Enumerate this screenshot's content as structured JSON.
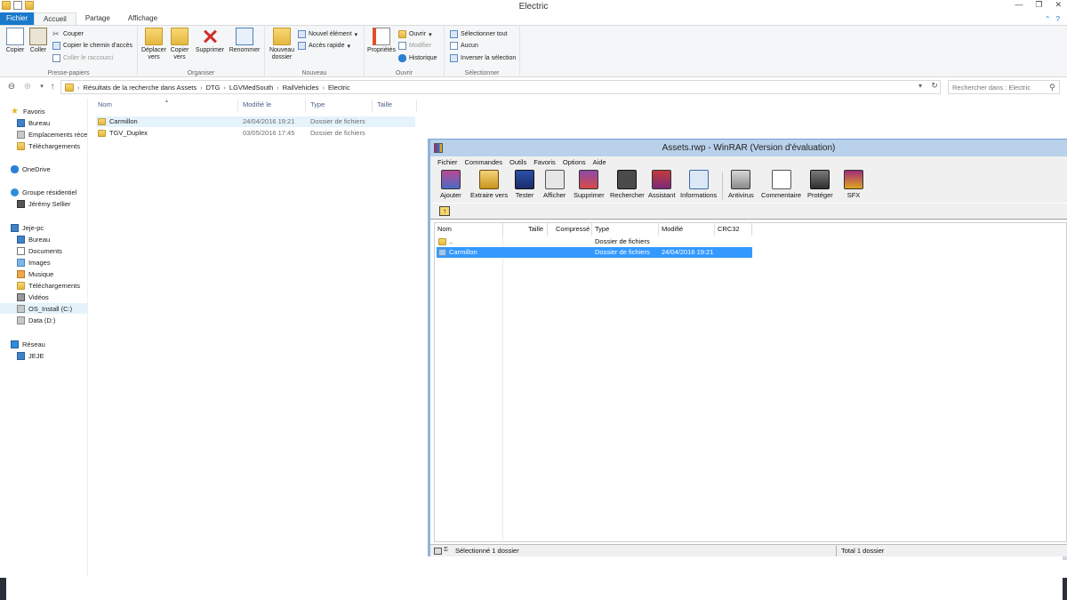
{
  "window": {
    "title": "Electric"
  },
  "ribbon_tabs": [
    "Fichier",
    "Accueil",
    "Partage",
    "Affichage"
  ],
  "ribbon": {
    "clipboard": {
      "copy": "Copier",
      "paste": "Coller",
      "cut": "Couper",
      "copy_path": "Copier le chemin d'accès",
      "paste_shortcut": "Coller le raccourci",
      "label": "Presse-papiers"
    },
    "organize": {
      "move_to": "Déplacer vers",
      "copy_to": "Copier vers",
      "delete": "Supprimer",
      "rename": "Renommer",
      "label": "Organiser"
    },
    "new": {
      "new_folder": "Nouveau dossier",
      "new_item": "Nouvel élément",
      "easy_access": "Accès rapide",
      "label": "Nouveau"
    },
    "open": {
      "properties": "Propriétés",
      "open": "Ouvrir",
      "edit": "Modifier",
      "history": "Historique",
      "label": "Ouvrir"
    },
    "select": {
      "select_all": "Sélectionner tout",
      "select_none": "Aucun",
      "invert": "Inverser la sélection",
      "label": "Sélectionner"
    }
  },
  "address": {
    "breadcrumb": [
      "Résultats de la recherche dans Assets",
      "DTG",
      "LGVMedSouth",
      "RailVehicles",
      "Electric"
    ],
    "search_placeholder": "Rechercher dans : Electric"
  },
  "nav_pane": {
    "favorites": "Favoris",
    "fav_items": [
      "Bureau",
      "Emplacements récents",
      "Téléchargements"
    ],
    "onedrive": "OneDrive",
    "homegroup": "Groupe résidentiel",
    "homegroup_user": "Jérémy Sellier",
    "pc": "Jeje-pc",
    "pc_items": [
      "Bureau",
      "Documents",
      "Images",
      "Musique",
      "Téléchargements",
      "Vidéos",
      "OS_Install (C:)",
      "Data (D:)"
    ],
    "network": "Réseau",
    "network_items": [
      "JEJE"
    ]
  },
  "file_list": {
    "columns": [
      "Nom",
      "Modifié le",
      "Type",
      "Taille"
    ],
    "rows": [
      {
        "name": "Carmillon",
        "modified": "24/04/2016 19:21",
        "type": "Dossier de fichiers",
        "size": ""
      },
      {
        "name": "TGV_Duplex",
        "modified": "03/05/2016 17:45",
        "type": "Dossier de fichiers",
        "size": ""
      }
    ]
  },
  "winrar": {
    "title": "Assets.rwp - WinRAR (Version d'évaluation)",
    "menu": [
      "Fichier",
      "Commandes",
      "Outils",
      "Favoris",
      "Options",
      "Aide"
    ],
    "toolbar": [
      "Ajouter",
      "Extraire vers",
      "Tester",
      "Afficher",
      "Supprimer",
      "Rechercher",
      "Assistant",
      "Informations",
      "Antivirus",
      "Commentaire",
      "Protéger",
      "SFX"
    ],
    "columns": [
      "Nom",
      "Taille",
      "Compressé",
      "Type",
      "Modifié",
      "CRC32"
    ],
    "rows": [
      {
        "name": "..",
        "type": "Dossier de fichiers",
        "modified": ""
      },
      {
        "name": "Carmillon",
        "type": "Dossier de fichiers",
        "modified": "24/04/2016 19:21"
      }
    ],
    "status_left": "Sélectionné 1 dossier",
    "status_right": "Total 1 dossier"
  },
  "colors": {
    "accent": "#1979ca",
    "selection": "#3399ff",
    "winrar_title": "#b9d1ea"
  }
}
